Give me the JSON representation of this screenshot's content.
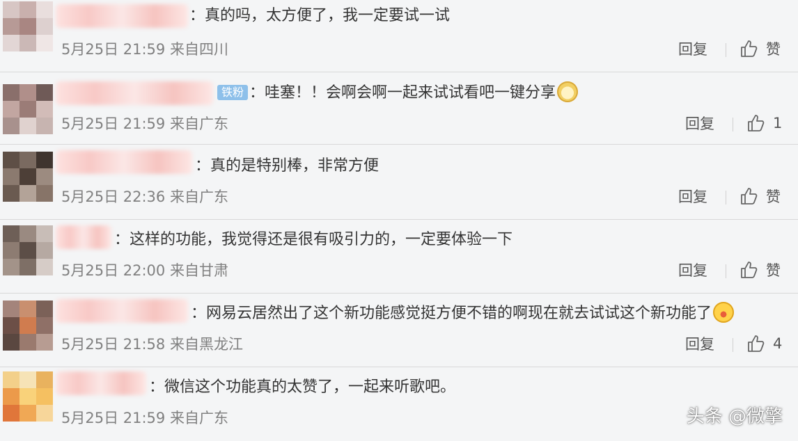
{
  "actions": {
    "reply_label": "回复"
  },
  "comments": [
    {
      "text": "：真的吗，太方便了，我一定要试一试",
      "meta": "5月25日 21:59 来自四川",
      "like": "赞"
    },
    {
      "badge": "铁粉",
      "text": "：哇塞！！会啊会啊一起来试试看吧一键分享",
      "meta": "5月25日 21:59 来自广东",
      "like": "1"
    },
    {
      "text": "：真的是特别棒，非常方便",
      "meta": "5月25日 22:36 来自广东",
      "like": "赞"
    },
    {
      "text": "：这样的功能，我觉得还是很有吸引力的，一定要体验一下",
      "meta": "5月25日 22:00 来自甘肃",
      "like": "赞"
    },
    {
      "text": "：网易云居然出了这个新功能感觉挺方便不错的啊现在就去试试这个新功能了",
      "meta": "5月25日 21:58 来自黑龙江",
      "like": "4"
    },
    {
      "text": "：微信这个功能真的太赞了，一起来听歌吧。",
      "meta": "5月25日 21:59 来自广东"
    }
  ],
  "watermark": "头条 @微擎",
  "colors": {
    "meta": "#808080",
    "text": "#333333",
    "badge": "#8ec0ea",
    "background": "#f4f5f6"
  }
}
